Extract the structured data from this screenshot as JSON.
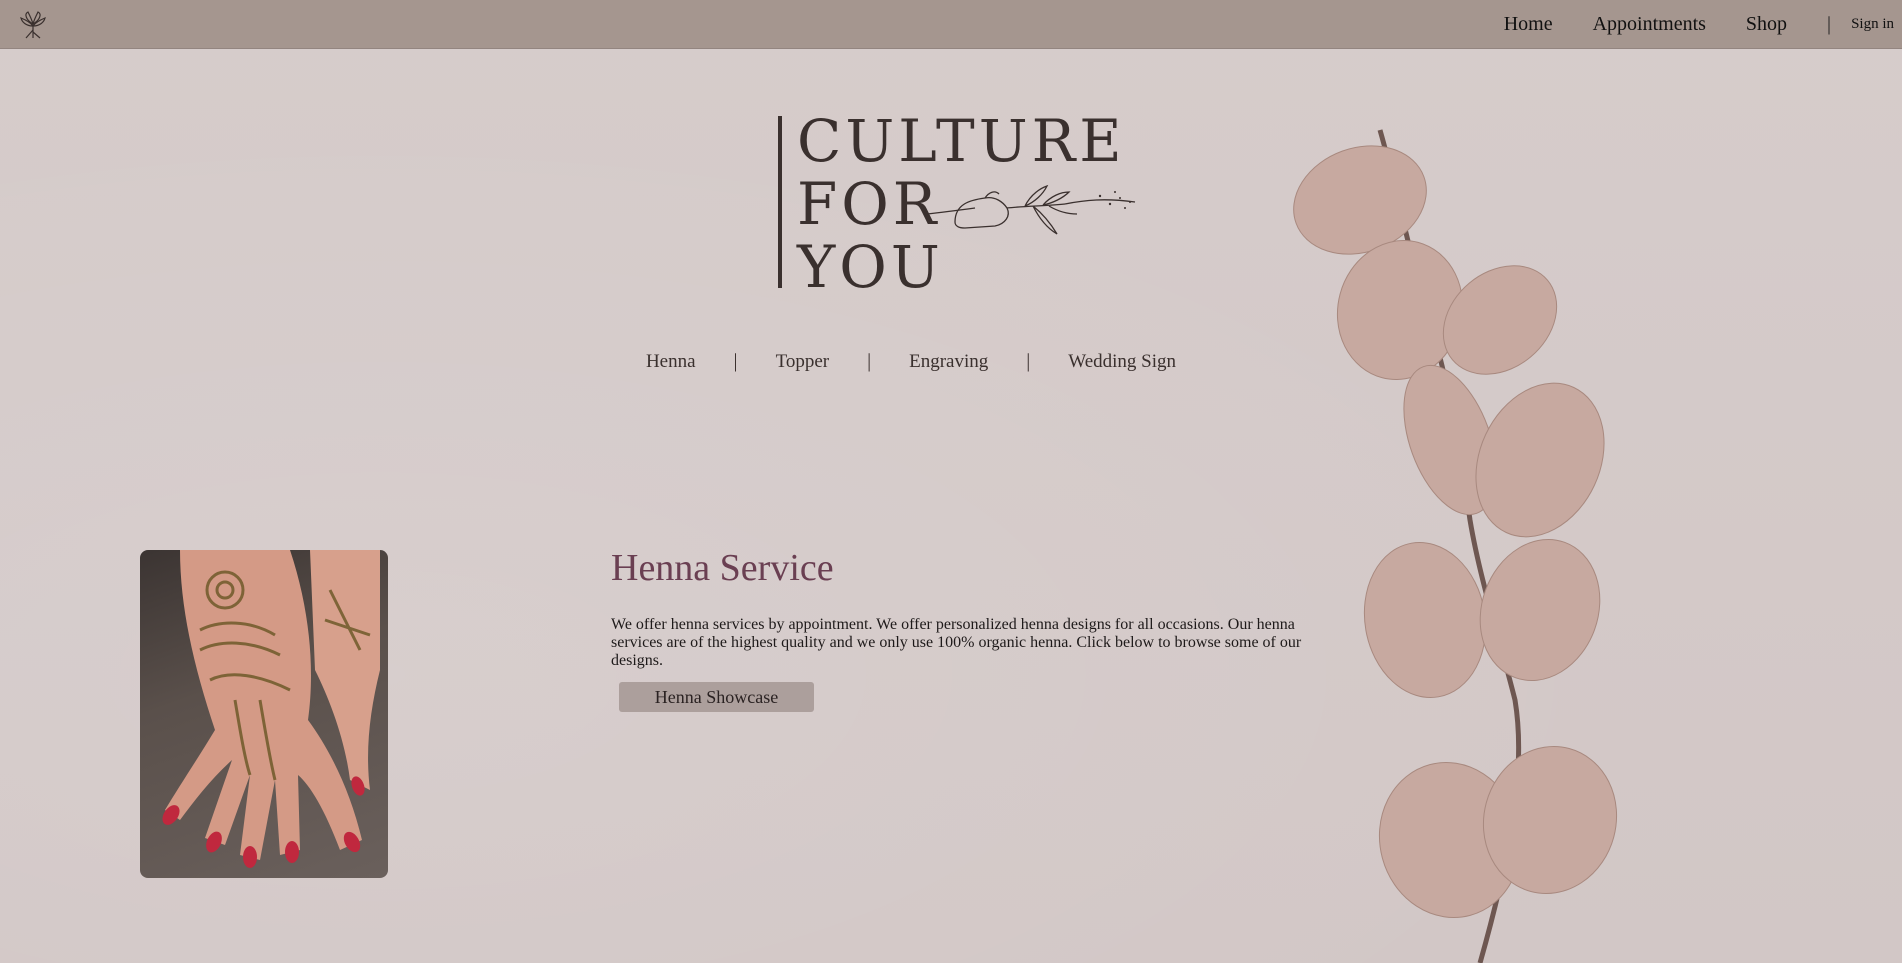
{
  "header": {
    "nav": [
      "Home",
      "Appointments",
      "Shop"
    ],
    "separator": "|",
    "signin_label": "Sign in"
  },
  "logo": {
    "lines": [
      "CULTURE",
      "FOR",
      "YOU"
    ]
  },
  "categories": {
    "items": [
      "Henna",
      "Topper",
      "Engraving",
      "Wedding Sign"
    ],
    "separator": "|"
  },
  "main": {
    "title": "Henna Service",
    "description": "We offer henna services by appointment. We offer personalized henna designs for all occasions. Our henna services are of the highest quality and we only use 100% organic henna. Click below to browse some of our designs.",
    "button_label": "Henna Showcase"
  },
  "icons": {
    "site_logo": "lily-flower-icon",
    "logo_art": "hand-holding-sprig-icon"
  },
  "colors": {
    "topbar": "#a5968f",
    "background": "#d4c9c7",
    "title": "#6a3f52",
    "button": "#ac9f9c"
  }
}
